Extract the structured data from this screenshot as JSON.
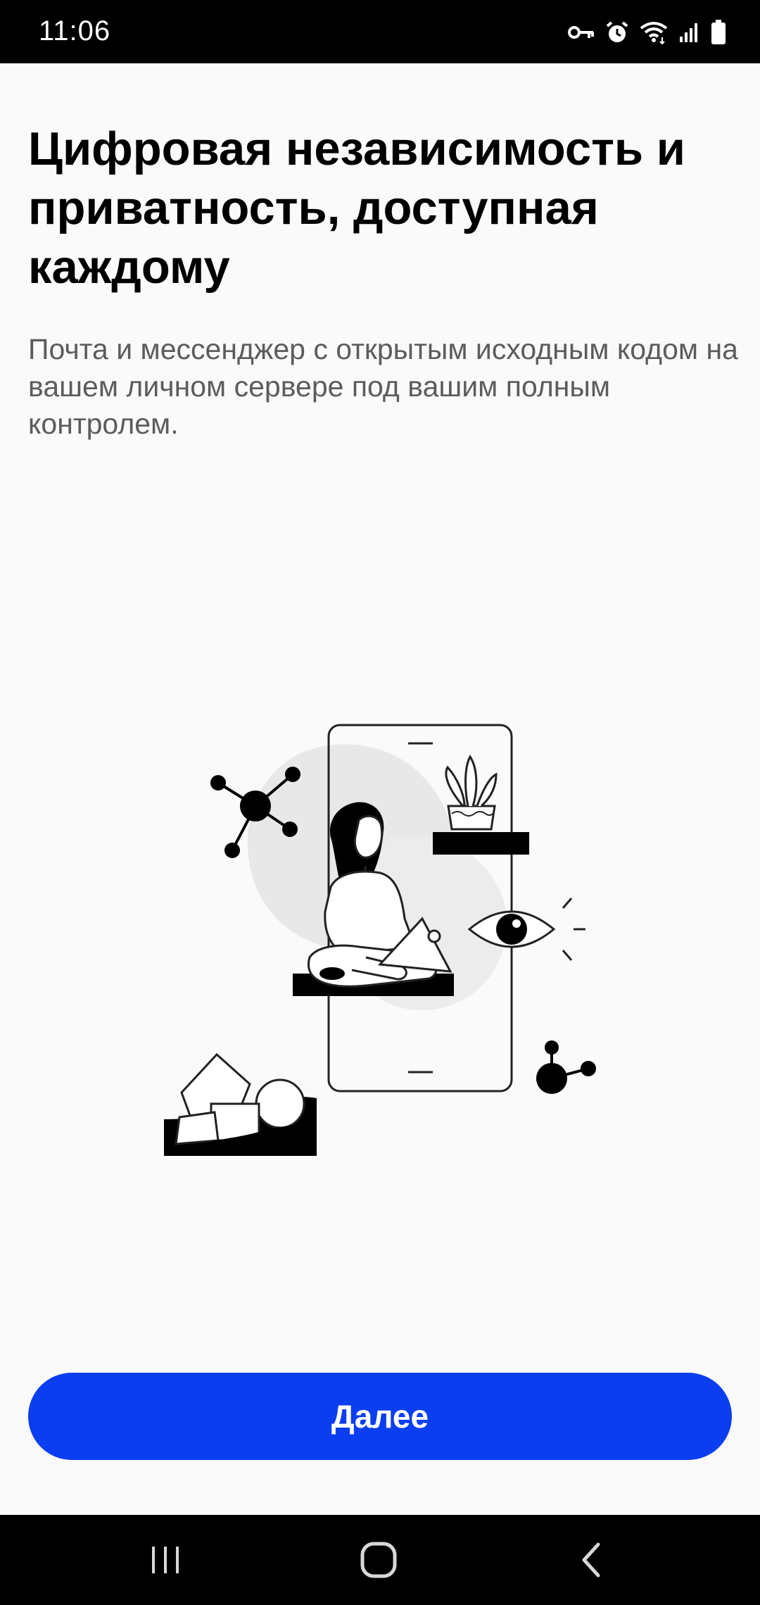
{
  "status_bar": {
    "time": "11:06",
    "icons": [
      "vpn-key-icon",
      "alarm-icon",
      "wifi-icon",
      "signal-icon",
      "battery-icon"
    ]
  },
  "onboarding": {
    "headline": "Цифровая независимость и приватность, доступная каждому",
    "subtitle": "Почта и мессенджер с открытым исходным кодом на вашем личном сервере под вашим полным контролем.",
    "illustration": "person-with-laptop-on-phone-illustration"
  },
  "actions": {
    "next_label": "Далее"
  },
  "nav_bar": {
    "icons": [
      "recent-apps-icon",
      "home-icon",
      "back-icon"
    ]
  },
  "colors": {
    "accent": "#0b3ef0",
    "background": "#fafafa",
    "bars": "#000000"
  }
}
